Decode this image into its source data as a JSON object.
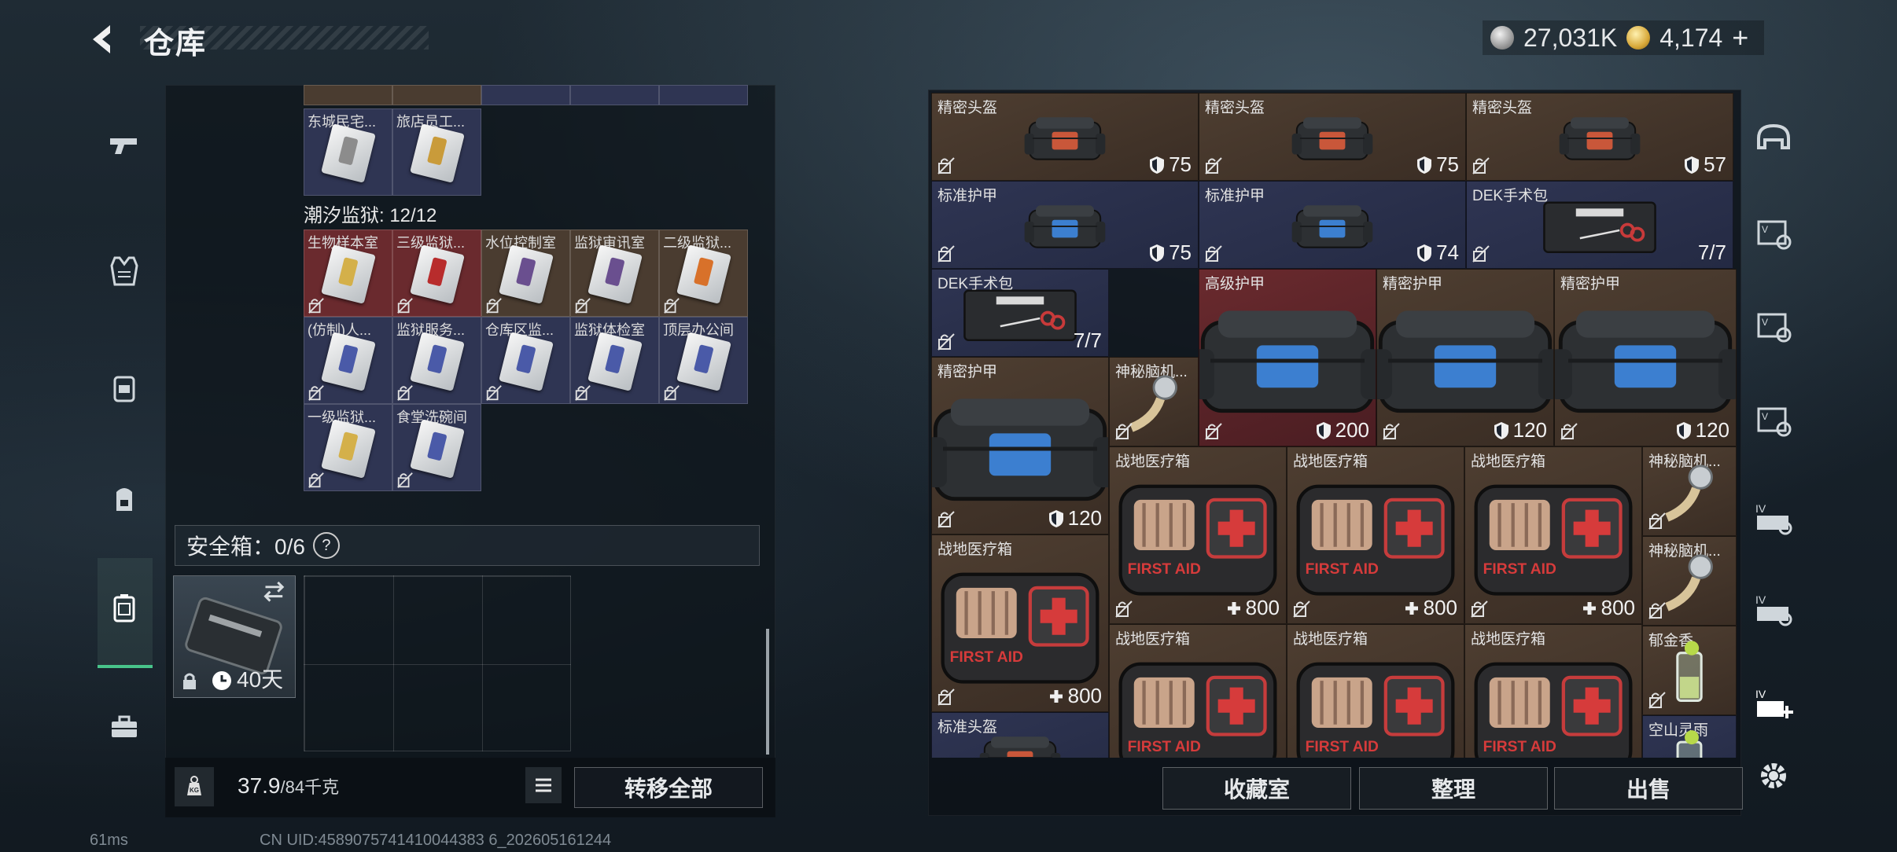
{
  "header": {
    "title": "仓库"
  },
  "currency": {
    "silver": "27,031K",
    "gold": "4,174",
    "add": "+"
  },
  "prison": {
    "label": "潮汐监狱: 12/12"
  },
  "top_cards": [
    {
      "label": "东城民宅...",
      "tag": "#8c8c8c"
    },
    {
      "label": "旅店员工...",
      "tag": "#c99b3a"
    }
  ],
  "prison_cards": [
    {
      "label": "生物样本室",
      "tag": "#d4b04a",
      "bg": "#6a2a2e"
    },
    {
      "label": "三级监狱...",
      "tag": "#b82c2c",
      "bg": "#6a2a2e"
    },
    {
      "label": "水位控制室",
      "tag": "#6a4f8f",
      "bg": "#4a3c30"
    },
    {
      "label": "监狱审讯室",
      "tag": "#6a4f8f",
      "bg": "#4a3c30"
    },
    {
      "label": "二级监狱...",
      "tag": "#d8712a",
      "bg": "#4a3c30"
    },
    {
      "label": "(仿制)人...",
      "tag": "#4a5aa8",
      "bg": "#2f3553"
    },
    {
      "label": "监狱服务...",
      "tag": "#4a5aa8",
      "bg": "#2f3553"
    },
    {
      "label": "仓库区监...",
      "tag": "#4a5aa8",
      "bg": "#2f3553"
    },
    {
      "label": "监狱体检室",
      "tag": "#4a5aa8",
      "bg": "#2f3553"
    },
    {
      "label": "顶层办公间",
      "tag": "#4a5aa8",
      "bg": "#2f3553"
    },
    {
      "label": "一级监狱...",
      "tag": "#d4b04a",
      "bg": "#2f3553"
    },
    {
      "label": "食堂洗碗间",
      "tag": "#4a5aa8",
      "bg": "#2f3553"
    }
  ],
  "safe_box": {
    "label": "安全箱：0/6",
    "help": "?",
    "case_timer": "40天"
  },
  "weight": {
    "current": "37.9",
    "max": "/84千克"
  },
  "buttons": {
    "transfer_all": "转移全部",
    "collection": "收藏室",
    "organize": "整理",
    "sell": "出售"
  },
  "status": {
    "ping": "61ms",
    "uid": "CN UID:4589075741410044383 6_202605161244"
  },
  "inventory": [
    {
      "name": "精密头盔",
      "value": "75",
      "icon": "shield",
      "color": "brown",
      "art": "helmet"
    },
    {
      "name": "精密头盔",
      "value": "75",
      "icon": "shield",
      "color": "brown",
      "art": "helmet"
    },
    {
      "name": "精密头盔",
      "value": "57",
      "icon": "shield",
      "color": "brown",
      "art": "helmet"
    },
    {
      "name": "标准护甲",
      "value": "75",
      "icon": "shield",
      "color": "navy",
      "art": "armor"
    },
    {
      "name": "标准护甲",
      "value": "74",
      "icon": "shield",
      "color": "navy",
      "art": "armor"
    },
    {
      "name": "DEK手术包",
      "value": "7/7",
      "icon": "none",
      "color": "navy",
      "art": "surgery"
    },
    {
      "name": "DEK手术包",
      "value": "7/7",
      "icon": "none",
      "color": "navy",
      "art": "surgery"
    },
    {
      "name": "高级护甲",
      "value": "200",
      "icon": "shield",
      "color": "red",
      "art": "armor_big"
    },
    {
      "name": "精密护甲",
      "value": "120",
      "icon": "shield",
      "color": "brown",
      "art": "armor_big"
    },
    {
      "name": "精密护甲",
      "value": "120",
      "icon": "shield",
      "color": "brown",
      "art": "armor_big"
    },
    {
      "name": "精密护甲",
      "value": "120",
      "icon": "shield",
      "color": "brown",
      "art": "armor_big"
    },
    {
      "name": "神秘脑机...",
      "value": "",
      "icon": "none",
      "color": "brown",
      "art": "brain"
    },
    {
      "name": "战地医疗箱",
      "value": "800",
      "icon": "plus",
      "color": "brown",
      "art": "medkit"
    },
    {
      "name": "战地医疗箱",
      "value": "800",
      "icon": "plus",
      "color": "brown",
      "art": "medkit"
    },
    {
      "name": "战地医疗箱",
      "value": "800",
      "icon": "plus",
      "color": "brown",
      "art": "medkit"
    },
    {
      "name": "神秘脑机...",
      "value": "",
      "icon": "none",
      "color": "brown",
      "art": "brain"
    },
    {
      "name": "战地医疗箱",
      "value": "800",
      "icon": "plus",
      "color": "brown",
      "art": "medkit"
    },
    {
      "name": "神秘脑机...",
      "value": "",
      "icon": "none",
      "color": "brown",
      "art": "brain"
    },
    {
      "name": "战地医疗箱",
      "value": "",
      "icon": "none",
      "color": "brown",
      "art": "medkit"
    },
    {
      "name": "战地医疗箱",
      "value": "",
      "icon": "none",
      "color": "brown",
      "art": "medkit"
    },
    {
      "name": "战地医疗箱",
      "value": "",
      "icon": "none",
      "color": "brown",
      "art": "medkit"
    },
    {
      "name": "郁金香",
      "value": "",
      "icon": "none",
      "color": "brown",
      "art": "drink"
    },
    {
      "name": "标准头盔",
      "value": "",
      "icon": "none",
      "color": "navy",
      "art": "helmet"
    },
    {
      "name": "空山灵雨",
      "value": "",
      "icon": "none",
      "color": "navy",
      "art": "drink"
    }
  ],
  "side_icons": [
    "helmet-slot-icon",
    "armor-slot-icon",
    "armor-slot-icon",
    "armor-slot-icon",
    "medkit-level-icon",
    "medkit-level-icon",
    "add-medkit-icon",
    "settings-gear-icon"
  ],
  "rail_icons": [
    "pistol-icon",
    "armor-vest-icon",
    "chest-rig-icon",
    "backpack-icon",
    "secure-case-icon",
    "toolbox-icon"
  ]
}
